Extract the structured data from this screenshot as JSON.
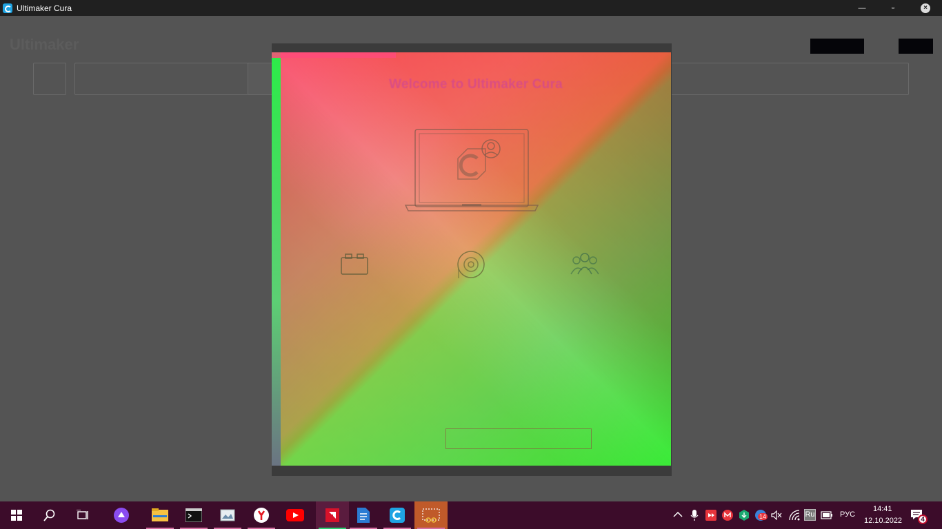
{
  "window": {
    "title": "Ultimaker Cura",
    "minimize_glyph": "—",
    "restore_glyph": "▫",
    "close_glyph": "×"
  },
  "background_app": {
    "logo_text": "Ultimaker"
  },
  "dialog": {
    "title": "Welcome to Ultimaker Cura",
    "illustration": "laptop-account-icon",
    "feature_icons": [
      "marketplace-plugin-icon",
      "help-support-icon",
      "community-icon"
    ],
    "primary_button_label": ""
  },
  "taskbar": {
    "items": [
      "start-icon",
      "search-icon",
      "task-view-icon",
      "alice-icon",
      "file-explorer-icon",
      "terminal-icon",
      "photos-icon",
      "yandex-browser-icon",
      "youtube-icon",
      "amd-icon",
      "notepad-icon",
      "cura-icon",
      "snipping-tool-icon"
    ],
    "tray": {
      "language": "РУС",
      "keyboard_layout": "Ru",
      "badge_count": "14",
      "time": "14:41",
      "date": "12.10.2022",
      "notifications_count": "4"
    }
  },
  "colors": {
    "titlebar": "#202020",
    "taskbar": "#3c0c2a",
    "cura_blue": "#1fa4e3",
    "overlay_bg": "#545454"
  }
}
